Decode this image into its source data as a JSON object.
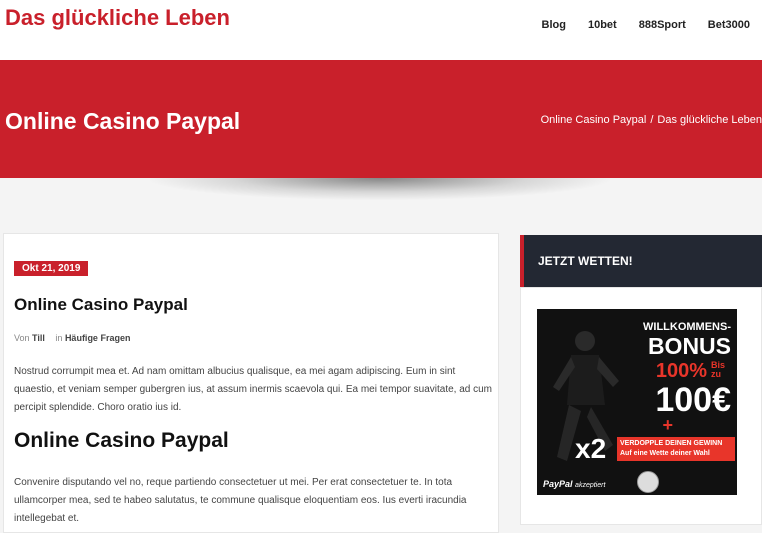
{
  "site": {
    "title": "Das glückliche Leben"
  },
  "nav": {
    "items": [
      "Blog",
      "10bet",
      "888Sport",
      "Bet3000"
    ]
  },
  "hero": {
    "title": "Online Casino Paypal",
    "breadcrumb": [
      "Online Casino Paypal",
      "Das glückliche Leben"
    ],
    "separator": "/"
  },
  "post": {
    "date": "Okt 21, 2019",
    "title": "Online Casino Paypal",
    "meta": {
      "by_label": "Von",
      "author": "Till",
      "in_label": "in",
      "category": "Häufige Fragen"
    },
    "para1": "Nostrud corrumpit mea et. Ad nam omittam albucius qualisque, ea mei agam adipiscing. Eum in sint quaestio, et veniam semper gubergren ius, at assum inermis scaevola qui. Ea mei tempor suavitate, ad cum percipit splendide. Choro oratio ius id.",
    "heading": "Online Casino Paypal",
    "para2": "Convenire disputando vel no, reque partiendo consectetuer ut mei. Per erat consectetuer te. In tota ullamcorper mea, sed te habeo salutatus, te commune qualisque eloquentiam eos. Ius everti iracundia intellegebat et."
  },
  "sidebar": {
    "widget_title": "JETZT WETTEN!",
    "banner": {
      "line1": "WILLKOMMENS-",
      "line2": "BONUS",
      "percent": "100%",
      "bis_zu": "Bis zu",
      "amount": "100€",
      "plus": "+",
      "x2": "x2",
      "offer": "VERDOPPLE DEINEN GEWINN Auf eine Wette deiner Wahl",
      "paypal": "PayPal",
      "paypal_note": "akzeptiert"
    }
  },
  "colors": {
    "accent": "#c9202b",
    "dark": "#232833"
  }
}
